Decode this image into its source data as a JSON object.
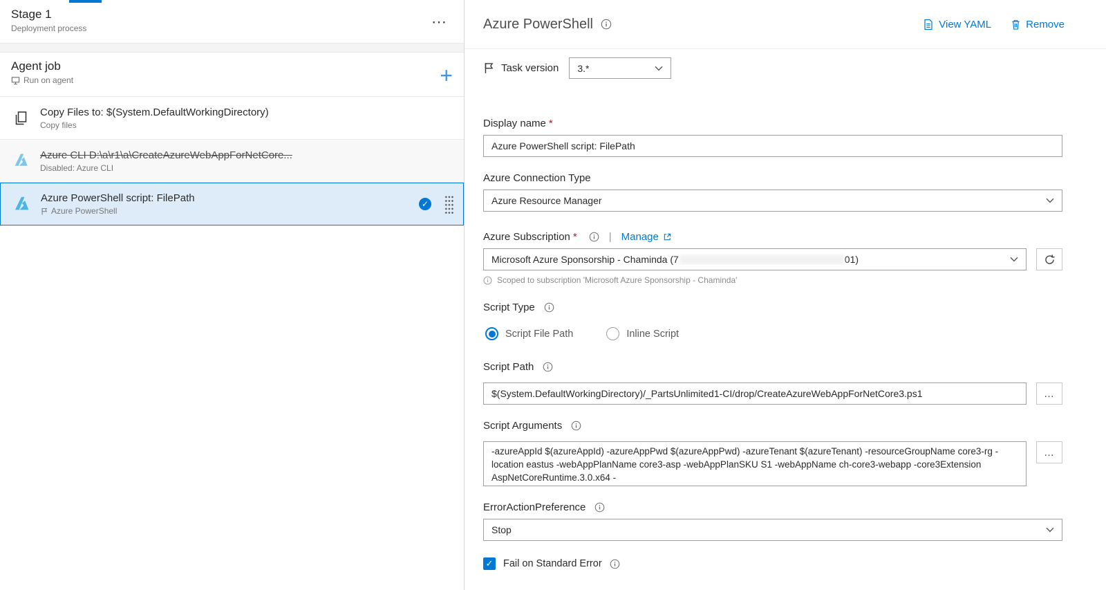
{
  "colors": {
    "accent": "#0078d4",
    "selected_bg": "#deecf9",
    "task_icon_blue": "#56b7e6"
  },
  "left": {
    "stage_title": "Stage 1",
    "stage_subtitle": "Deployment process",
    "stage_menu": "⋯",
    "agent_job_title": "Agent job",
    "agent_job_subtitle": "Run on agent",
    "add_button": "+",
    "tasks": [
      {
        "title": "Copy Files to: $(System.DefaultWorkingDirectory)",
        "subtitle": "Copy files"
      },
      {
        "title": "Azure CLI D:\\a\\r1\\a\\CreateAzureWebAppForNetCore...",
        "subtitle": "Disabled: Azure CLI"
      },
      {
        "title": "Azure PowerShell script: FilePath",
        "subtitle": "Azure PowerShell"
      }
    ],
    "selected_check": "✓"
  },
  "right": {
    "title": "Azure PowerShell",
    "view_yaml": "View YAML",
    "remove": "Remove",
    "task_version_label": "Task version",
    "task_version_value": "3.*",
    "required_marker": "*",
    "display_name_label": "Display name",
    "display_name_value": "Azure PowerShell script: FilePath",
    "connection_type_label": "Azure Connection Type",
    "connection_type_value": "Azure Resource Manager",
    "subscription_label": "Azure Subscription",
    "manage_label": "Manage",
    "subscription_value_prefix": "Microsoft Azure Sponsorship - Chaminda (7",
    "subscription_value_suffix": "01)",
    "scoped_note": "Scoped to subscription 'Microsoft Azure Sponsorship - Chaminda'",
    "script_type_label": "Script Type",
    "script_type_options": [
      "Script File Path",
      "Inline Script"
    ],
    "script_path_label": "Script Path",
    "script_path_value": "$(System.DefaultWorkingDirectory)/_PartsUnlimited1-CI/drop/CreateAzureWebAppForNetCore3.ps1",
    "script_args_label": "Script Arguments",
    "script_args_value": "-azureAppId $(azureAppId) -azureAppPwd $(azureAppPwd) -azureTenant $(azureTenant) -resourceGroupName core3-rg -location eastus -webAppPlanName core3-asp -webAppPlanSKU S1 -webAppName ch-core3-webapp -core3Extension AspNetCoreRuntime.3.0.x64 -",
    "error_action_label": "ErrorActionPreference",
    "error_action_value": "Stop",
    "fail_stderr_label": "Fail on Standard Error",
    "ellipsis_button": "…"
  }
}
